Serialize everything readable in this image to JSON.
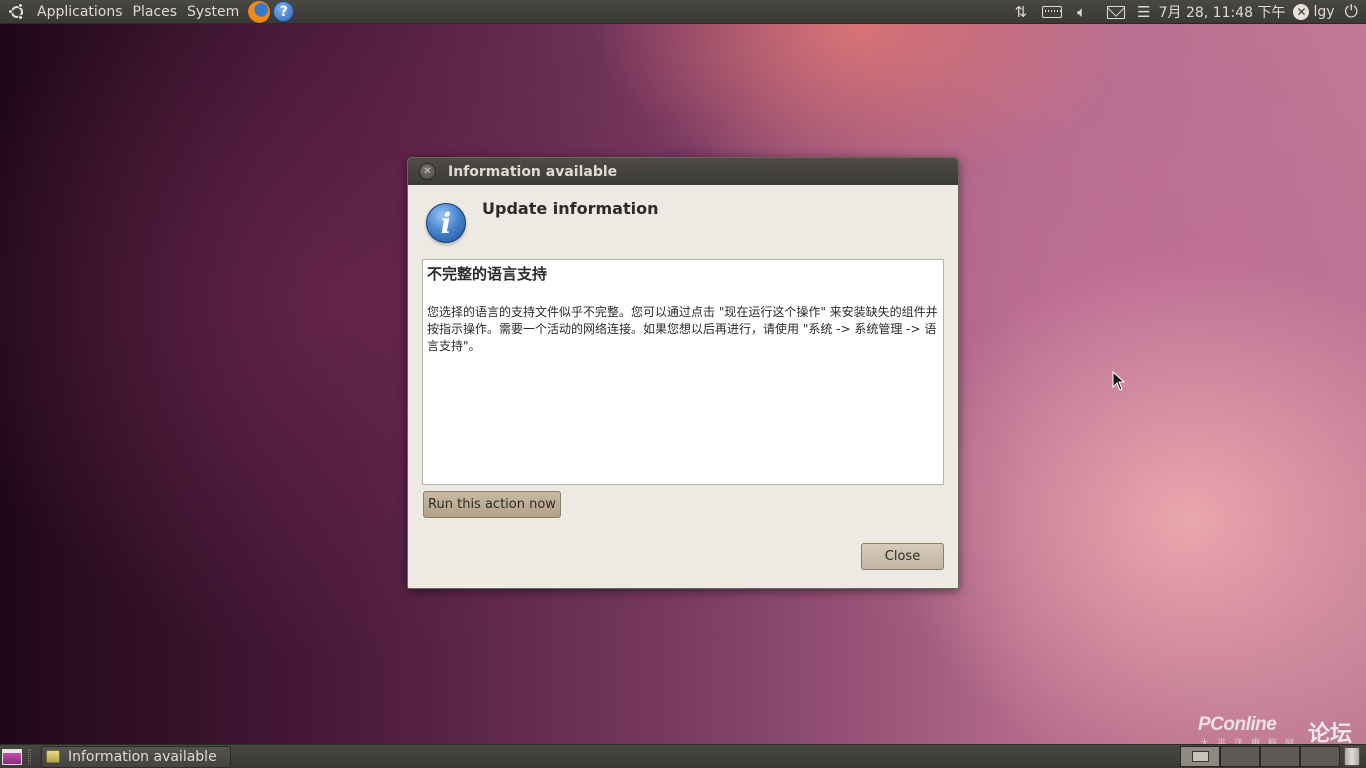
{
  "top_panel": {
    "menus": [
      "Applications",
      "Places",
      "System"
    ],
    "help_glyph": "?",
    "clock": "7月 28, 11:48 下午",
    "username": "lgy",
    "icons": {
      "network": "network-updown-icon",
      "keyboard": "keyboard-icon",
      "volume": "volume-icon",
      "mail": "mail-icon",
      "user": "user-status-icon",
      "power": "power-icon"
    }
  },
  "dialog": {
    "title": "Information available",
    "header": "Update information",
    "content_title": "不完整的语言支持",
    "content_body": "您选择的语言的支持文件似乎不完整。您可以通过点击 \"现在运行这个操作\" 来安装缺失的组件并按指示操作。需要一个活动的网络连接。如果您想以后再进行，请使用 \"系统 -> 系统管理 -> 语言支持\"。",
    "run_button": "Run this action now",
    "close_button": "Close"
  },
  "taskbar": {
    "window_label": "Information available"
  },
  "watermark": {
    "logo": "PConline",
    "sub": "太平洋电脑网",
    "forum": "论坛"
  },
  "colors": {
    "panel": "#3c3b37",
    "dialog_bg": "#ede9e3",
    "button": "#c3b5a1"
  }
}
